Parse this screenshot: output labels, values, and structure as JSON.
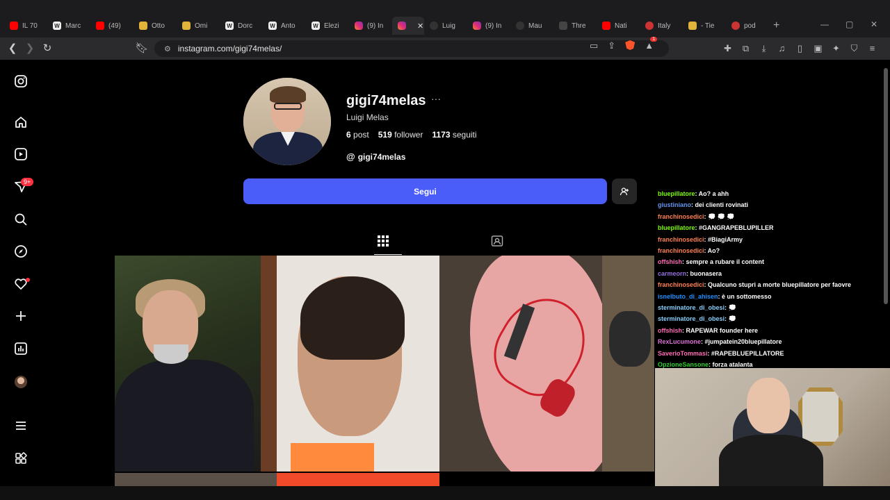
{
  "browser": {
    "tabs": [
      {
        "title": "IL 70",
        "icon": "youtube-icon",
        "kind": "yt"
      },
      {
        "title": "Marc",
        "icon": "wikipedia-icon",
        "kind": "wk",
        "glyph": "W"
      },
      {
        "title": "(49)",
        "icon": "youtube-icon",
        "kind": "yt"
      },
      {
        "title": "Otto",
        "icon": "wordpress-icon",
        "kind": "wp"
      },
      {
        "title": "Omi",
        "icon": "wordpress-icon",
        "kind": "wp"
      },
      {
        "title": "Dorc",
        "icon": "wikipedia-icon",
        "kind": "wk",
        "glyph": "W"
      },
      {
        "title": "Anto",
        "icon": "wikipedia-icon",
        "kind": "wk",
        "glyph": "W"
      },
      {
        "title": "Elezi",
        "icon": "wikipedia-icon",
        "kind": "wk",
        "glyph": "W"
      },
      {
        "title": "(9) In",
        "icon": "instagram-icon",
        "kind": "ig"
      },
      {
        "title": "",
        "icon": "instagram-icon",
        "kind": "ig",
        "active": true
      },
      {
        "title": "Luig",
        "icon": "threads-icon",
        "kind": "th"
      },
      {
        "title": "(9) In",
        "icon": "instagram-icon",
        "kind": "ig"
      },
      {
        "title": "Mau",
        "icon": "threads-icon",
        "kind": "th"
      },
      {
        "title": "Thre",
        "icon": "translate-icon",
        "kind": "tr"
      },
      {
        "title": "Nati",
        "icon": "youtube-icon",
        "kind": "yt"
      },
      {
        "title": "Italy",
        "icon": "site-icon",
        "kind": "xx"
      },
      {
        "title": "- Tie",
        "icon": "site-icon",
        "kind": "wp"
      },
      {
        "title": "pod",
        "icon": "site-icon",
        "kind": "xx"
      }
    ],
    "url": "instagram.com/gigi74melas/",
    "brave_badge": "1"
  },
  "sidebar": {
    "notifications_badge": "9+"
  },
  "profile": {
    "username": "gigi74melas",
    "more_glyph": "···",
    "full_name": "Luigi Melas",
    "posts_count": "6",
    "posts_label": "post",
    "followers_count": "519",
    "followers_label": "follower",
    "following_count": "1173",
    "following_label": "seguiti",
    "threads_handle": "gigi74melas",
    "follow_label": "Segui"
  },
  "chat": [
    {
      "user": "bluepillatore",
      "color": "#7CFC00",
      "msg": ": Ao? a ahh"
    },
    {
      "user": "giustiniano",
      "color": "#6495ED",
      "msg": ": dei clienti rovinati"
    },
    {
      "user": "franchinosedici",
      "color": "#FF7F50",
      "msg": ": 💭 💭 💭"
    },
    {
      "user": "bluepillatore",
      "color": "#7CFC00",
      "msg": ": #GANGRAPEBLUPILLER"
    },
    {
      "user": "franchinosedici",
      "color": "#FF7F50",
      "msg": ": #BiagiArmy"
    },
    {
      "user": "franchinosedici",
      "color": "#FF7F50",
      "msg": ": Ao?"
    },
    {
      "user": "offshish",
      "color": "#FF69B4",
      "msg": ": sempre a rubare il content"
    },
    {
      "user": "carmeorn",
      "color": "#9370DB",
      "msg": ": buonasera"
    },
    {
      "user": "franchinosedici",
      "color": "#FF7F50",
      "msg": ": Qualcuno stupri a morte bluepillatore per faovre"
    },
    {
      "user": "isnelbuto_di_ahisen",
      "color": "#1E90FF",
      "msg": ": è un sottomesso"
    },
    {
      "user": "sterminatore_di_obesi",
      "color": "#87CEFA",
      "msg": ": 💭"
    },
    {
      "user": "sterminatore_di_obesi",
      "color": "#87CEFA",
      "msg": ": 💭"
    },
    {
      "user": "offshish",
      "color": "#FF69B4",
      "msg": ": RAPEWAR founder here"
    },
    {
      "user": "RexLucumone",
      "color": "#DA70D6",
      "msg": ": #jumpatein20bluepillatore"
    },
    {
      "user": "SaverioTommasi",
      "color": "#FF6EB4",
      "msg": ": #RAPEBLUEPILLATORE"
    },
    {
      "user": "OpzioneSansone",
      "color": "#32CD32",
      "msg": ": forza atalanta"
    }
  ]
}
